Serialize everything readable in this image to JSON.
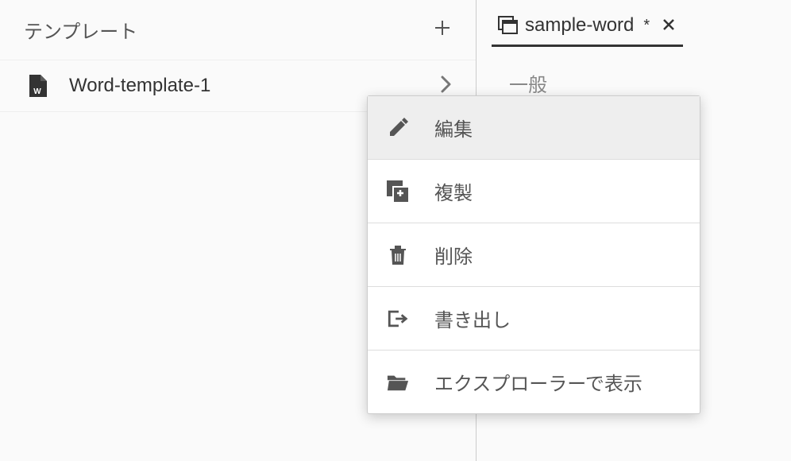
{
  "sidebar": {
    "title": "テンプレート",
    "items": [
      {
        "name": "Word-template-1"
      }
    ]
  },
  "tab": {
    "label": "sample-word",
    "dirty_marker": "*"
  },
  "detail": {
    "section_title": "一般"
  },
  "context_menu": {
    "items": [
      {
        "label": "編集"
      },
      {
        "label": "複製"
      },
      {
        "label": "削除"
      },
      {
        "label": "書き出し"
      },
      {
        "label": "エクスプローラーで表示"
      }
    ]
  }
}
